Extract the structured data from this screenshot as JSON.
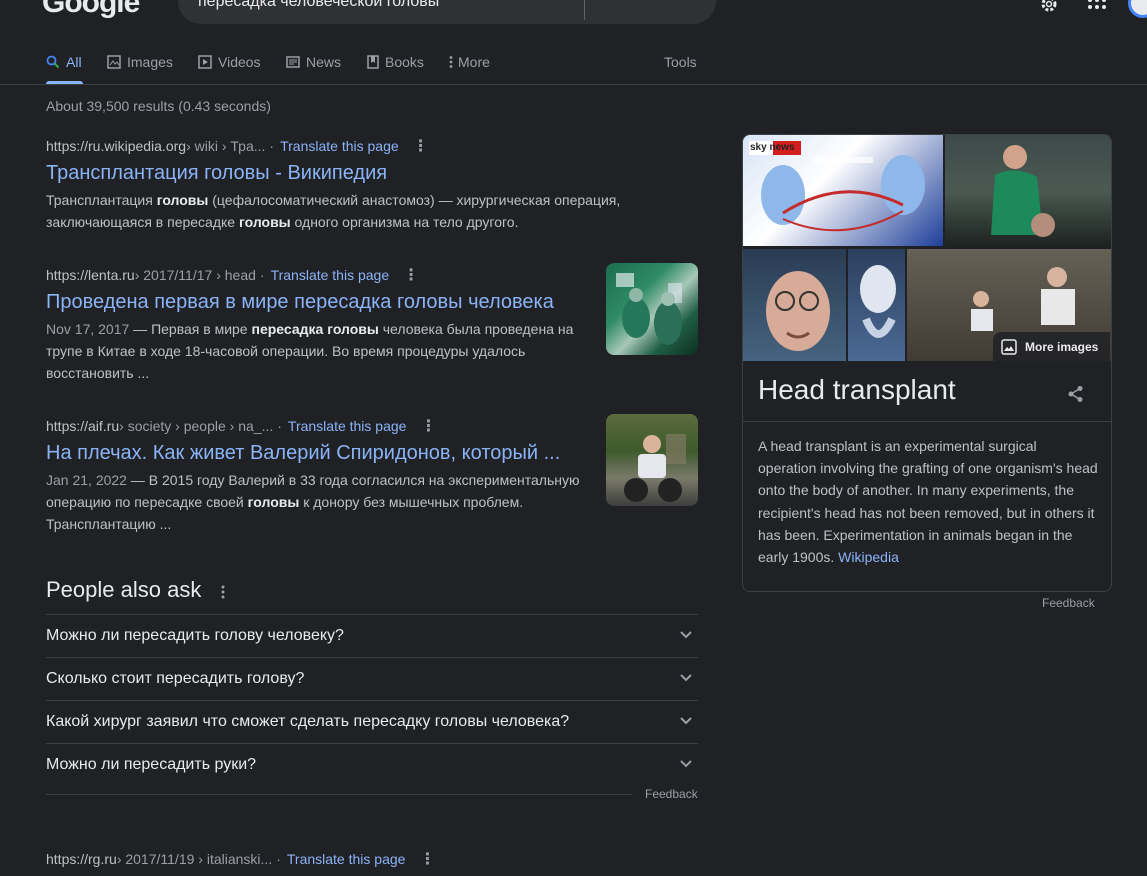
{
  "header": {
    "logo": "Google",
    "query": "пересадка человеческой головы"
  },
  "tabs": [
    {
      "label": "All",
      "icon": "search-icon"
    },
    {
      "label": "Images",
      "icon": "image-icon"
    },
    {
      "label": "Videos",
      "icon": "play-icon"
    },
    {
      "label": "News",
      "icon": "news-icon"
    },
    {
      "label": "Books",
      "icon": "book-icon"
    },
    {
      "label": "More",
      "icon": "more-vert-icon"
    }
  ],
  "tools_label": "Tools",
  "stats": "About 39,500 results (0.43 seconds)",
  "results": [
    {
      "site": "https://ru.wikipedia.org",
      "path": " › wiki › Тра...",
      "translate": "Translate this page",
      "title": "Трансплантация головы - Википедия",
      "snippet_html": "Трансплантация <b>головы</b> (цефалосоматический анастомоз) — хирургическая операция, заключающаяся в пересадке <b>головы</b> одного организма на тело другого."
    },
    {
      "site": "https://lenta.ru",
      "path": " › 2017/11/17 › head",
      "translate": "Translate this page",
      "title": "Проведена первая в мире пересадка головы человека",
      "date": "Nov 17, 2017",
      "snippet_html": " — Первая в мире <b>пересадка головы</b> человека была проведена на трупе в Китае в ходе 18-часовой операции. Во время процедуры удалось восстановить ..."
    },
    {
      "site": "https://aif.ru",
      "path": " › society › people › na_...",
      "translate": "Translate this page",
      "title": "На плечах. Как живет Валерий Спиридонов, который ...",
      "date": "Jan 21, 2022",
      "snippet_html": " — В 2015 году Валерий в 33 года согласился на экспериментальную операцию по пересадке своей <b>головы</b> к донору без мышечных проблем. Трансплантацию ..."
    },
    {
      "site": "https://rg.ru",
      "path": " › 2017/11/19 › italianski...",
      "translate": "Translate this page"
    }
  ],
  "people_also_ask": {
    "title": "People also ask",
    "questions": [
      "Можно ли пересадить голову человеку?",
      "Сколько стоит пересадить голову?",
      "Какой хирург заявил что сможет сделать пересадку головы человека?",
      "Можно ли пересадить руки?"
    ],
    "feedback": "Feedback"
  },
  "knowledge_panel": {
    "title": "Head transplant",
    "more_images": "More images",
    "sky_label": "sky news",
    "description": "A head transplant is an experimental surgical operation involving the grafting of one organism's head onto the body of another. In many experiments, the recipient's head has not been removed, but in others it has been. Experimentation in animals began in the early 1900s. ",
    "source_link": "Wikipedia",
    "feedback": "Feedback"
  },
  "colors": {
    "background": "#202124",
    "link": "#8ab4f8",
    "text": "#bdc1c6",
    "muted": "#9aa0a6"
  }
}
